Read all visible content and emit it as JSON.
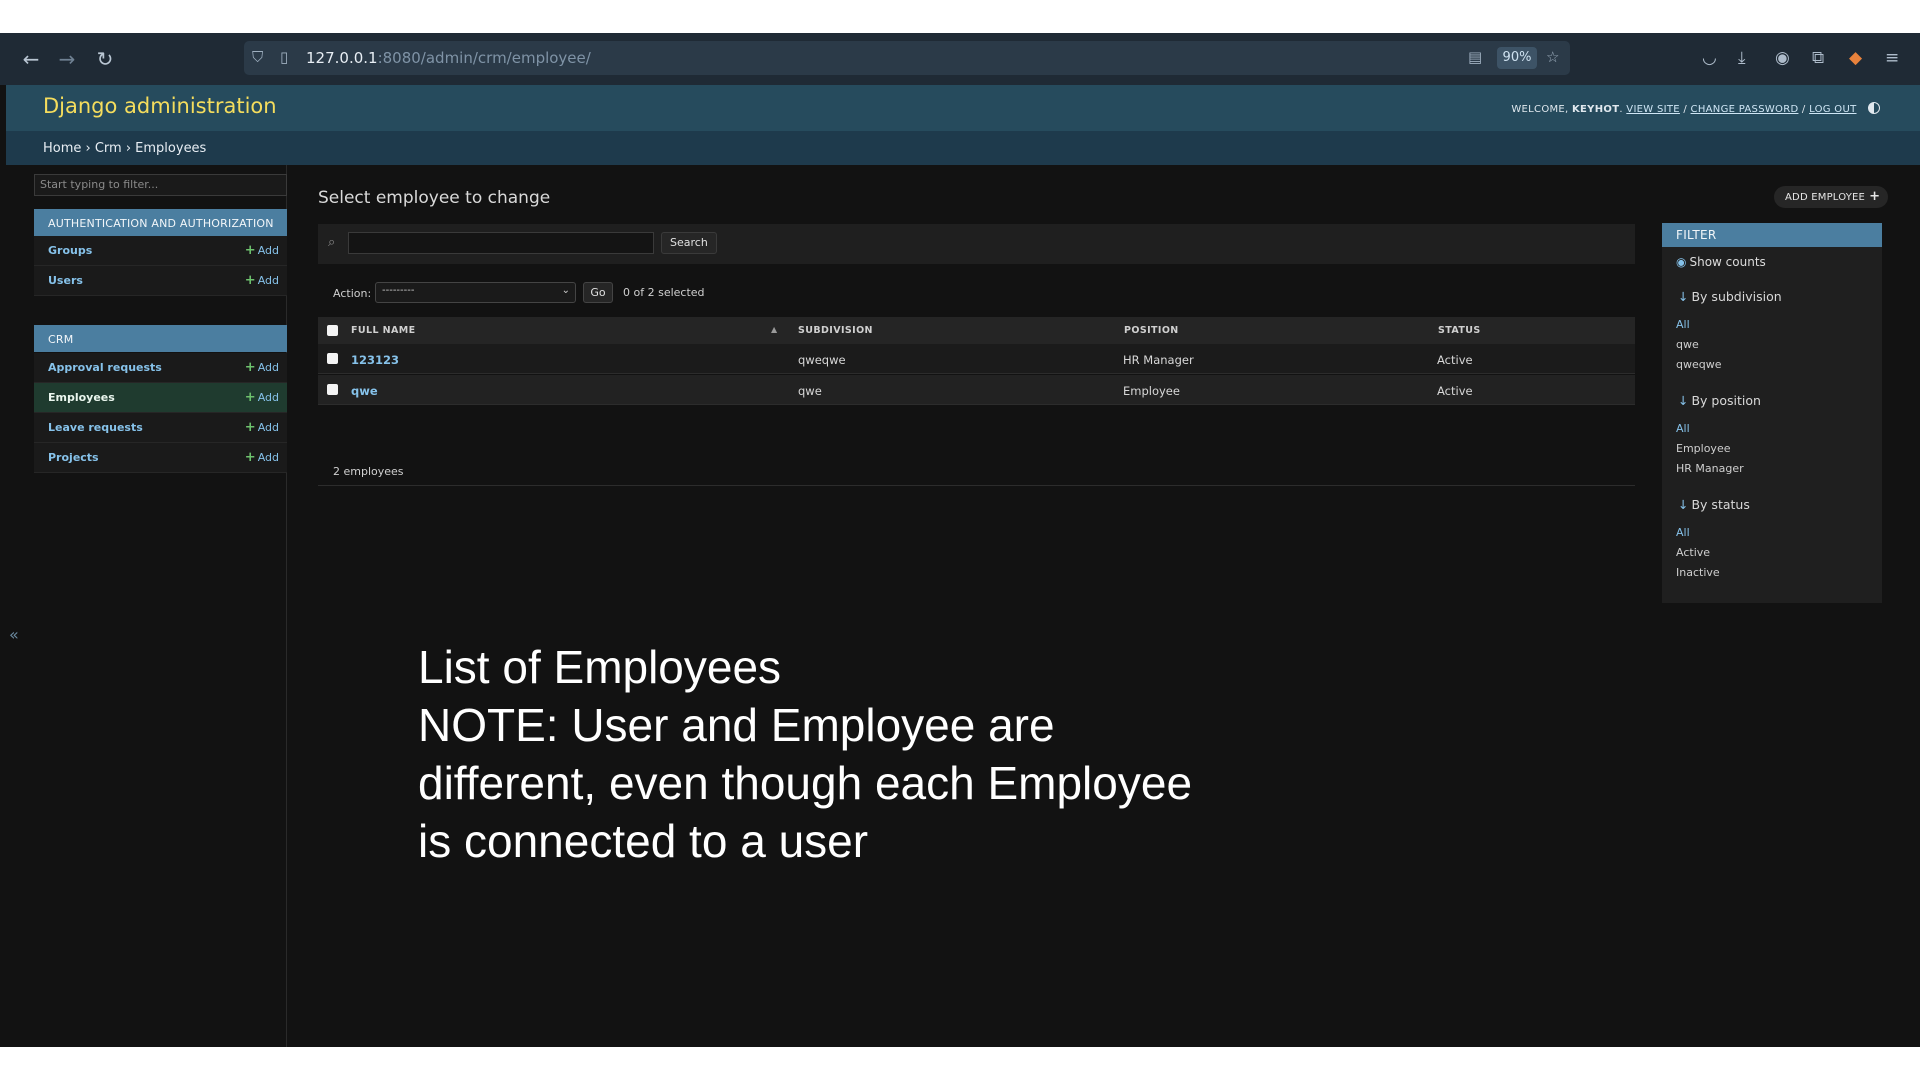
{
  "browser": {
    "url_host": "127.0.0.1",
    "url_rest": ":8080/admin/crm/employee/",
    "zoom": "90%"
  },
  "header": {
    "branding": "Django administration",
    "welcome": "WELCOME, ",
    "username": "KEYHOT",
    "view_site": "VIEW SITE",
    "change_password": "CHANGE PASSWORD",
    "log_out": "LOG OUT",
    "sep": " / "
  },
  "breadcrumbs": "Home › Crm › Employees",
  "sidebar": {
    "filter_placeholder": "Start typing to filter...",
    "add_label": "Add",
    "apps": [
      {
        "caption": "AUTHENTICATION AND AUTHORIZATION",
        "models": [
          "Groups",
          "Users"
        ]
      },
      {
        "caption": "CRM",
        "models": [
          "Approval requests",
          "Employees",
          "Leave requests",
          "Projects"
        ]
      }
    ],
    "collapse_icon": "«"
  },
  "content": {
    "title": "Select employee to change",
    "add_button": "ADD EMPLOYEE",
    "search_button": "Search",
    "action_label": "Action:",
    "action_selected": "---------",
    "go_button": "Go",
    "selection_count": "0 of 2 selected",
    "columns": [
      "FULL NAME",
      "SUBDIVISION",
      "POSITION",
      "STATUS"
    ],
    "rows": [
      {
        "full_name": "123123",
        "subdivision": "qweqwe",
        "position": "HR Manager",
        "status": "Active"
      },
      {
        "full_name": "qwe",
        "subdivision": "qwe",
        "position": "Employee",
        "status": "Active"
      }
    ],
    "paginator": "2 employees"
  },
  "filter": {
    "title": "FILTER",
    "show_counts": "Show counts",
    "by_subdivision": "By subdivision",
    "subdivision_options": [
      "All",
      "qwe",
      "qweqwe"
    ],
    "by_position": "By position",
    "position_options": [
      "All",
      "Employee",
      "HR Manager"
    ],
    "by_status": "By status",
    "status_options": [
      "All",
      "Active",
      "Inactive"
    ]
  },
  "overlay": {
    "line1": "List of Employees",
    "line2": "NOTE: User and Employee are",
    "line3": "different, even though each Employee",
    "line4": "is connected to a user"
  },
  "colors": {
    "header_bg": "#264b5d",
    "branding": "#f5dd5d",
    "accent_link": "#86c2ea",
    "caption_bg": "#4b7ea0"
  }
}
